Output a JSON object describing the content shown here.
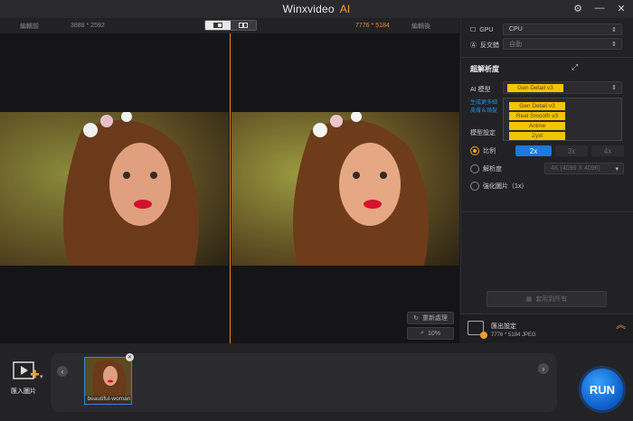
{
  "title": {
    "app": "Winxvideo",
    "ai": "AI"
  },
  "subbar": {
    "before_label": "編輯前",
    "before_res": "3888 * 2592",
    "after_res": "7776 * 5184",
    "after_label": "編輯後"
  },
  "viewer": {
    "reprocess_label": "重新處理",
    "zoom_label": "10%"
  },
  "sidebar": {
    "gpu_label": "GPU",
    "gpu_value": "CPU",
    "aa_label": "反交錯",
    "aa_value": "自動",
    "section_title": "超解析度",
    "model_label": "AI 模型",
    "model_value": "Gen Detail v3",
    "model_options": [
      "Gen Detail v3",
      "Real Smooth v3",
      "Anime",
      "Zyxt"
    ],
    "hint_line1": "生成更多細",
    "hint_line2": "皮膚＆頭髮",
    "mode_label": "模型設定",
    "scale_label": "比例",
    "scale_options": [
      "2x",
      "3x",
      "4x"
    ],
    "resolution_label": "解析度",
    "resolution_value": "4K (4096 X 4096)",
    "enhance_label": "強化圖片（1x）",
    "apply_all_label": "套用到所有"
  },
  "export": {
    "title": "匯出設定",
    "detail": "7776 * 5184  JPEG"
  },
  "bottom": {
    "import_label": "匯入圖片",
    "thumb_label": "beautiful-woman",
    "run_label": "RUN"
  },
  "colors": {
    "accent": "#f0a030",
    "option_bg": "#f3c400",
    "run_blue": "#1a7ae0"
  }
}
